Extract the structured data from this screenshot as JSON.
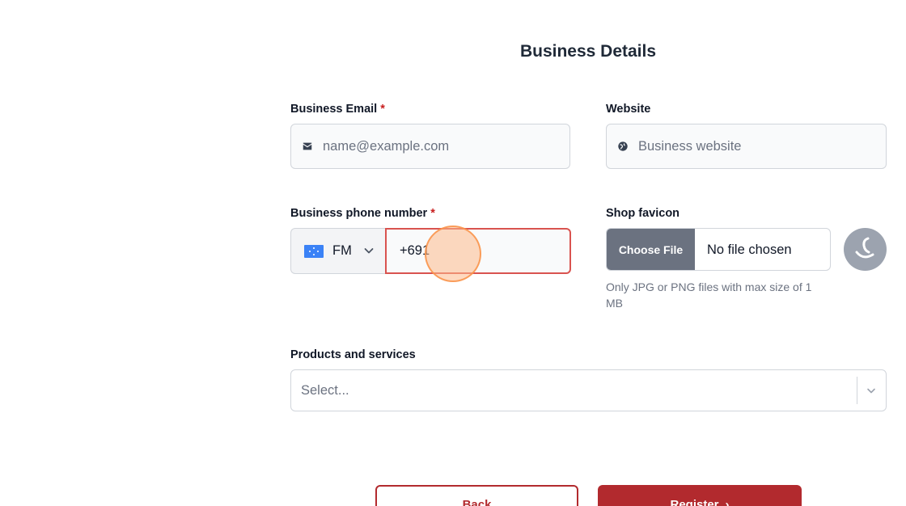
{
  "page": {
    "title": "Business Details"
  },
  "form": {
    "business_email": {
      "label": "Business Email",
      "required_mark": "*",
      "placeholder": "name@example.com",
      "icon": "envelope-icon"
    },
    "website": {
      "label": "Website",
      "placeholder": "Business website",
      "icon": "globe-icon"
    },
    "business_phone": {
      "label": "Business phone number",
      "required_mark": "*",
      "country_code": "FM",
      "flag": "micronesia-flag-icon",
      "value": "+691"
    },
    "shop_favicon": {
      "label": "Shop favicon",
      "choose_file_label": "Choose File",
      "no_file_text": "No file chosen",
      "help_text": "Only JPG or PNG files with max size of 1 MB"
    },
    "products_services": {
      "label": "Products and services",
      "placeholder": "Select..."
    }
  },
  "actions": {
    "back_label": "Back",
    "register_label": "Register",
    "register_icon": "arrow-right-icon"
  },
  "colors": {
    "accent": "#b22a2e",
    "error_border": "#d9534f",
    "required": "#c81e1e"
  }
}
